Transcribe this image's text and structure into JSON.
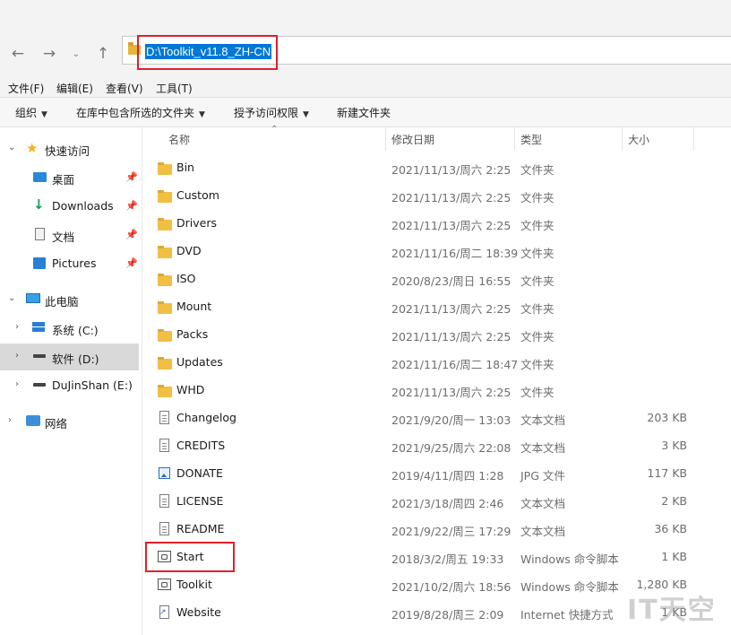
{
  "navigation": {
    "back_icon": "arrow-left-icon",
    "forward_icon": "arrow-right-icon",
    "recent_icon": "chevron-down-icon",
    "up_icon": "arrow-up-icon"
  },
  "address_bar": {
    "path": "D:\\Toolkit_v11.8_ZH-CN"
  },
  "menu": [
    "文件(F)",
    "编辑(E)",
    "查看(V)",
    "工具(T)"
  ],
  "toolbar": [
    "组织",
    "在库中包含所选的文件夹",
    "授予访问权限",
    "新建文件夹"
  ],
  "sidebar": {
    "quick_access": "快速访问",
    "quick_items": [
      "桌面",
      "Downloads",
      "文档",
      "Pictures"
    ],
    "this_pc": "此电脑",
    "drives": [
      "系统 (C:)",
      "软件 (D:)",
      "DuJinShan (E:)"
    ],
    "network": "网络"
  },
  "columns": {
    "name": "名称",
    "date": "修改日期",
    "type": "类型",
    "size": "大小"
  },
  "files": [
    {
      "name": "Bin",
      "date": "2021/11/13/周六 2:25",
      "type": "文件夹",
      "size": "",
      "icon": "folder"
    },
    {
      "name": "Custom",
      "date": "2021/11/13/周六 2:25",
      "type": "文件夹",
      "size": "",
      "icon": "folder"
    },
    {
      "name": "Drivers",
      "date": "2021/11/13/周六 2:25",
      "type": "文件夹",
      "size": "",
      "icon": "folder"
    },
    {
      "name": "DVD",
      "date": "2021/11/16/周二 18:39",
      "type": "文件夹",
      "size": "",
      "icon": "folder"
    },
    {
      "name": "ISO",
      "date": "2020/8/23/周日 16:55",
      "type": "文件夹",
      "size": "",
      "icon": "folder"
    },
    {
      "name": "Mount",
      "date": "2021/11/13/周六 2:25",
      "type": "文件夹",
      "size": "",
      "icon": "folder"
    },
    {
      "name": "Packs",
      "date": "2021/11/13/周六 2:25",
      "type": "文件夹",
      "size": "",
      "icon": "folder"
    },
    {
      "name": "Updates",
      "date": "2021/11/16/周二 18:47",
      "type": "文件夹",
      "size": "",
      "icon": "folder"
    },
    {
      "name": "WHD",
      "date": "2021/11/13/周六 2:25",
      "type": "文件夹",
      "size": "",
      "icon": "folder"
    },
    {
      "name": "Changelog",
      "date": "2021/9/20/周一 13:03",
      "type": "文本文档",
      "size": "203 KB",
      "icon": "doc"
    },
    {
      "name": "CREDITS",
      "date": "2021/9/25/周六 22:08",
      "type": "文本文档",
      "size": "3 KB",
      "icon": "doc"
    },
    {
      "name": "DONATE",
      "date": "2019/4/11/周四 1:28",
      "type": "JPG 文件",
      "size": "117 KB",
      "icon": "img"
    },
    {
      "name": "LICENSE",
      "date": "2021/3/18/周四 2:46",
      "type": "文本文档",
      "size": "2 KB",
      "icon": "doc"
    },
    {
      "name": "README",
      "date": "2021/9/22/周三 17:29",
      "type": "文本文档",
      "size": "36 KB",
      "icon": "doc"
    },
    {
      "name": "Start",
      "date": "2018/3/2/周五 19:33",
      "type": "Windows 命令脚本",
      "size": "1 KB",
      "icon": "cmd"
    },
    {
      "name": "Toolkit",
      "date": "2021/10/2/周六 18:56",
      "type": "Windows 命令脚本",
      "size": "1,280 KB",
      "icon": "cmd"
    },
    {
      "name": "Website",
      "date": "2019/8/28/周三 2:09",
      "type": "Internet 快捷方式",
      "size": "1 KB",
      "icon": "link"
    }
  ],
  "watermark": "IT天空",
  "colors": {
    "highlight": "#0078d7",
    "annotation_red": "#e0202a",
    "folder": "#f0bf44"
  }
}
